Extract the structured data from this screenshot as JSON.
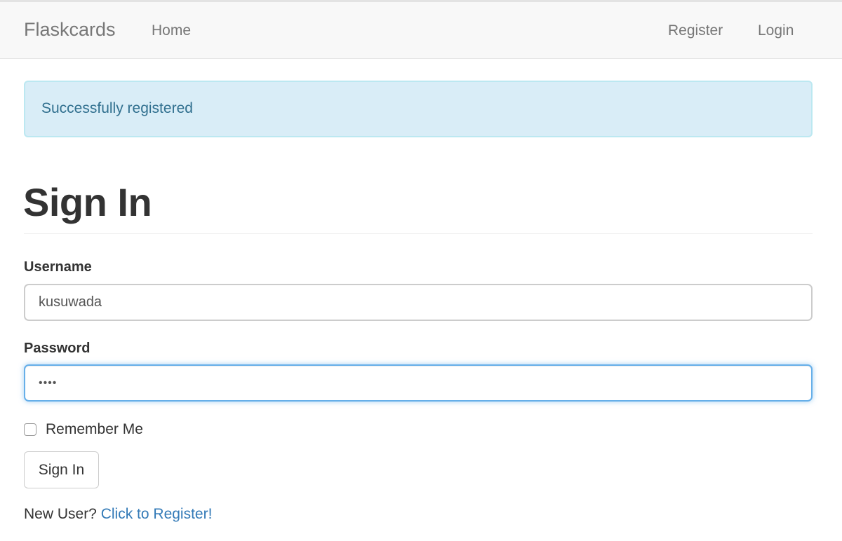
{
  "navbar": {
    "brand": "Flaskcards",
    "home": "Home",
    "register": "Register",
    "login": "Login"
  },
  "alert": {
    "message": "Successfully registered"
  },
  "form": {
    "title": "Sign In",
    "username_label": "Username",
    "username_value": "kusuwada",
    "password_label": "Password",
    "password_value": "••••",
    "remember_label": "Remember Me",
    "submit_label": "Sign In"
  },
  "footer": {
    "prompt": "New User?",
    "register_link": "Click to Register!"
  },
  "colors": {
    "navbar_bg": "#f8f8f8",
    "alert_bg": "#d9edf7",
    "alert_text": "#31708f",
    "link": "#337ab7",
    "focus_border": "#66afe9"
  }
}
